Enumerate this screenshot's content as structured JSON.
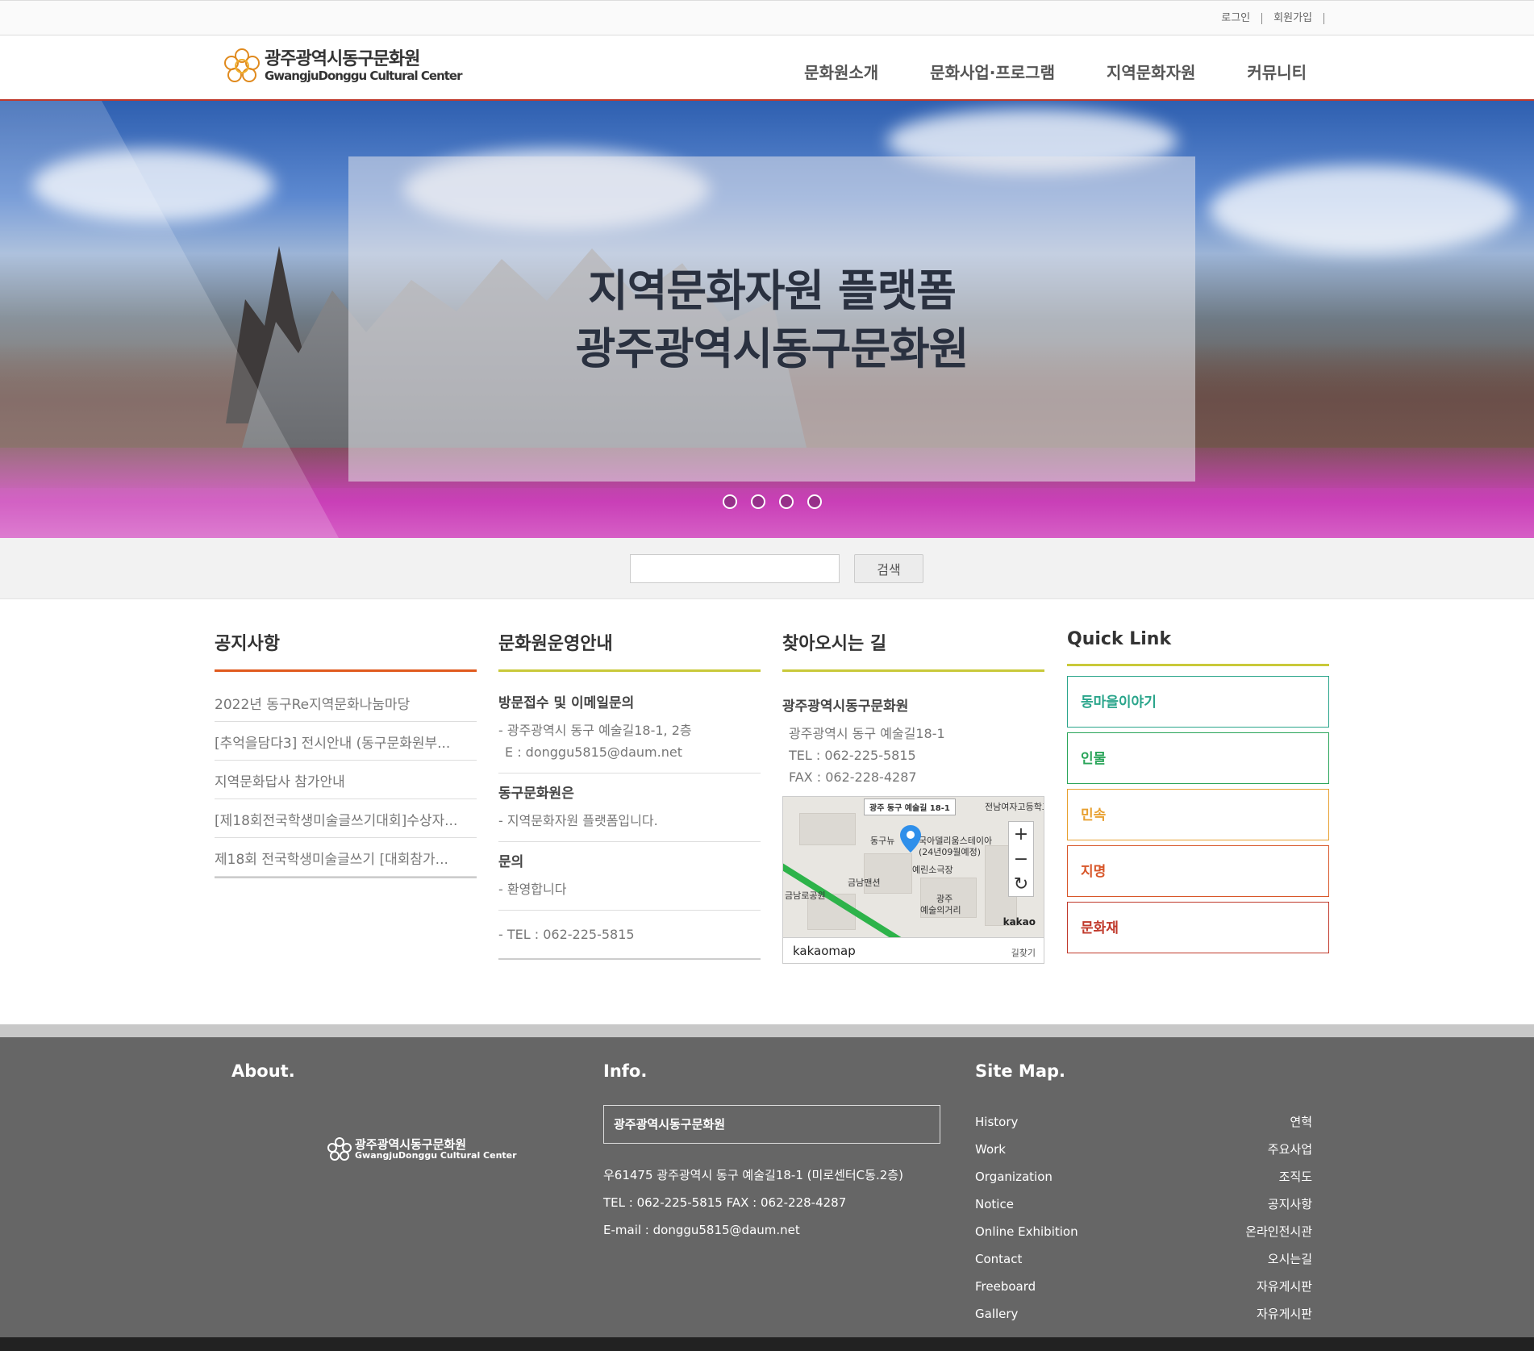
{
  "util": {
    "login": "로그인",
    "join": "회원가입"
  },
  "logo": {
    "name_ko": "광주광역시동구문화원",
    "name_en": "GwangjuDonggu Cultural Center"
  },
  "nav": [
    "문화원소개",
    "문화사업·프로그램",
    "지역문화자원",
    "커뮤니티"
  ],
  "hero": {
    "line1": "지역문화자원 플랫폼",
    "line2": "광주광역시동구문화원",
    "slide_count": 4
  },
  "search": {
    "placeholder": "",
    "button": "검색"
  },
  "notice": {
    "title": "공지사항",
    "items": [
      "2022년 동구Re지역문화나눔마당",
      "[추억을담다3] 전시안내 (동구문화원부...",
      "지역문화답사 참가안내",
      "[제18회전국학생미술글쓰기대회]수상자...",
      "제18회 전국학생미술글쓰기 [대회참가..."
    ]
  },
  "guide": {
    "title": "문화원운영안내",
    "sec1_title": "방문접수 및 이메일문의",
    "sec1_line1": "- 광주광역시 동구 예술길18-1, 2층",
    "sec1_line2": "E : donggu5815@daum.net",
    "sec2_title": "동구문화원은",
    "sec2_line1": "- 지역문화자원 플랫폼입니다.",
    "sec3_title": "문의",
    "sec3_line1": "- 환영합니다",
    "tel": "- TEL : 062-225-5815"
  },
  "way": {
    "title": "찾아오시는 길",
    "name": "광주광역시동구문화원",
    "addr": "광주광역시 동구 예술길18-1",
    "tel": "TEL : 062-225-5815",
    "fax": "FAX : 062-228-4287",
    "map_top": "광주 동구 예술길 18-1",
    "map_labels": [
      "전남여자고등학교",
      "동구뉴",
      "국아델리움스테이아",
      "(24년09월예정)",
      "예린소극장",
      "금남맨션",
      "금남로공원",
      "광주",
      "예술의거리"
    ],
    "map_brand": "kakaomap",
    "map_find": "길찾기",
    "map_kakao": "kakao"
  },
  "quick": {
    "title": "Quick Link",
    "links": [
      {
        "label": "동마을이야기",
        "color": "#2aa58b"
      },
      {
        "label": "인물",
        "color": "#2aa55a"
      },
      {
        "label": "민속",
        "color": "#e8a030"
      },
      {
        "label": "지명",
        "color": "#d8572a"
      },
      {
        "label": "문화재",
        "color": "#c0392b"
      }
    ]
  },
  "footer": {
    "about": "About.",
    "info": "Info.",
    "sitemap": "Site Map.",
    "info_name": "광주광역시동구문화원",
    "addr1": "우61475 광주광역시 동구 예술길18-1 (미로센터C동.2층)",
    "addr2": "TEL : 062-225-5815 FAX : 062-228-4287",
    "addr3": "E-mail : donggu5815@daum.net",
    "sitemap_items": [
      {
        "en": "History",
        "ko": "연혁"
      },
      {
        "en": "Work",
        "ko": "주요사업"
      },
      {
        "en": "Organization",
        "ko": "조직도"
      },
      {
        "en": "Notice",
        "ko": "공지사항"
      },
      {
        "en": "Online Exhibition",
        "ko": "온라인전시관"
      },
      {
        "en": "Contact",
        "ko": "오시는길"
      },
      {
        "en": "Freeboard",
        "ko": "자유게시판"
      },
      {
        "en": "Gallery",
        "ko": "자유게시판"
      }
    ]
  }
}
